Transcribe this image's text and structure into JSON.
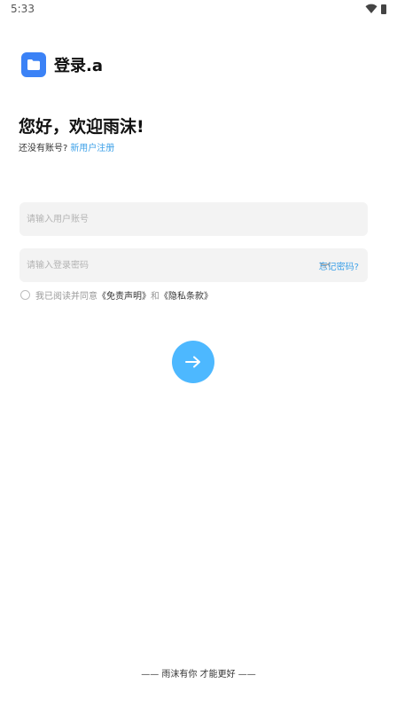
{
  "status_bar": {
    "time": "5:33"
  },
  "header": {
    "title": "登录.a"
  },
  "greeting": "您好，欢迎雨沫!",
  "register": {
    "prompt": "还没有账号?",
    "link": "新用户注册"
  },
  "form": {
    "username_placeholder": "请输入用户账号",
    "password_placeholder": "请输入登录密码",
    "forgot_label": "忘记密码?"
  },
  "agreement": {
    "prefix": "我已阅读并同意",
    "disclaimer": "《免责声明》",
    "joiner": "和",
    "privacy": "《隐私条款》"
  },
  "footer": "—— 雨沫有你 才能更好 ——",
  "colors": {
    "accent": "#4db8ff",
    "link": "#3ea1e8",
    "logo": "#3b82f6"
  }
}
